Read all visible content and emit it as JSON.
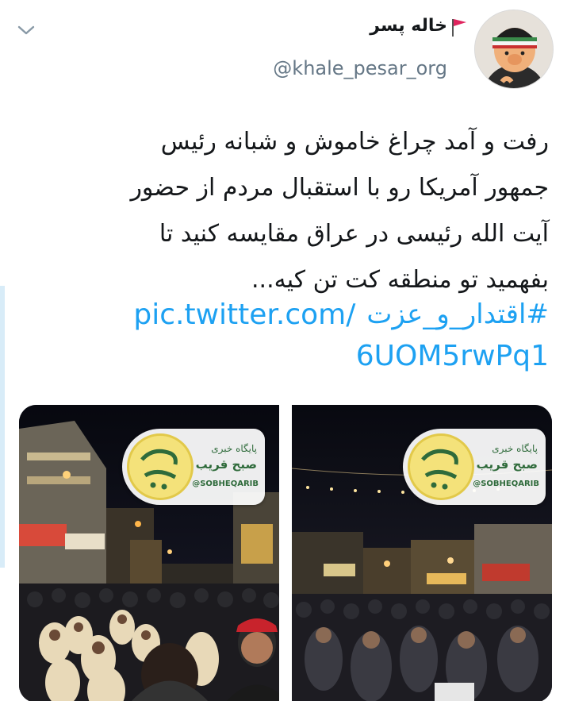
{
  "user": {
    "display_name": "خاله پسر",
    "handle": "@khale_pesar_org"
  },
  "tweet": {
    "lines": [
      "رفت و آمد چراغ خاموش و شبانه رئیس",
      "جمهور آمریکا رو با استقبال مردم از حضور",
      "آیت الله رئیسی در عراق مقایسه کنید تا",
      "بفهمید تو منطقه کت تن کیه..."
    ],
    "hashtag": "#اقتدار_و_عزت",
    "link_part1": "pic.twitter.com/",
    "link_part2": "6UOM5rwPq1"
  },
  "watermark": {
    "subtitle": "پایگاه خبری",
    "title": "صبح قریب",
    "handle": "@SOBHEQARIB"
  },
  "icons": {
    "menu": "chevron-down-icon",
    "flag": "red-flag-icon",
    "avatar": "avatar-puppet"
  },
  "colors": {
    "link": "#1da1f2",
    "handle_gray": "#657786",
    "text": "#14171a",
    "watermark_green": "#2f6b3b",
    "watermark_yellow": "#f4e27a"
  }
}
